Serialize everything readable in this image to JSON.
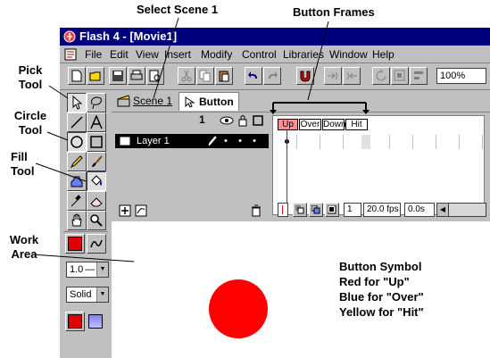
{
  "annotations": {
    "select_scene": "Select Scene 1",
    "button_frames": "Button Frames",
    "pick_tool": [
      "Pick",
      "Tool"
    ],
    "circle_tool": [
      "Circle",
      "Tool"
    ],
    "fill_tool": [
      "Fill",
      "Tool"
    ],
    "work_area": [
      "Work",
      "Area"
    ],
    "symbol_note": [
      "Button Symbol",
      "Red for \"Up\"",
      "Blue for \"Over\"",
      "Yellow for \"Hit\""
    ]
  },
  "window": {
    "title": "Flash 4 - [Movie1]"
  },
  "menu": [
    "File",
    "Edit",
    "View",
    "Insert",
    "Modify",
    "Control",
    "Libraries",
    "Window",
    "Help"
  ],
  "toolbar": {
    "zoom": "100%"
  },
  "tabs": {
    "scene": "Scene 1",
    "symbol": "Button 1"
  },
  "layers": {
    "layer1": "Layer 1"
  },
  "frames": [
    "Up",
    "Over",
    "Down",
    "Hit"
  ],
  "status": {
    "frame": "1",
    "fps": "20.0 fps",
    "time": "0.0s"
  },
  "tool_options": {
    "line_width": "1.0",
    "line_style": "Solid"
  },
  "colors": {
    "stroke": "#e00000",
    "fill": "#e00000",
    "circle": "#ff0000",
    "title_bg": "#00007f",
    "active_frame": "#ff9090"
  }
}
